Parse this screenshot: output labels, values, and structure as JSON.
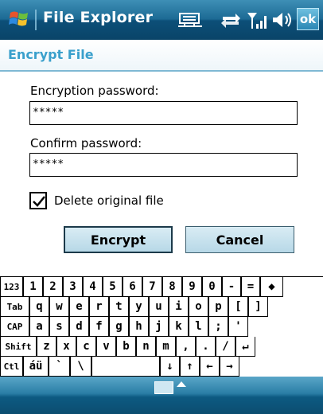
{
  "titlebar": {
    "title": "File Explorer",
    "ok_label": "ok",
    "icons": [
      "windows-start-icon",
      "connectivity-icon",
      "sync-icon",
      "signal-icon",
      "volume-icon"
    ]
  },
  "dialog": {
    "title": "Encrypt File",
    "encryption_label": "Encryption password:",
    "encryption_value": "*****",
    "confirm_label": "Confirm password:",
    "confirm_value": "*****",
    "delete_checkbox_label": "Delete original file",
    "delete_checked": true,
    "encrypt_button": "Encrypt",
    "cancel_button": "Cancel"
  },
  "keyboard": {
    "rows": [
      [
        "123",
        "1",
        "2",
        "3",
        "4",
        "5",
        "6",
        "7",
        "8",
        "9",
        "0",
        "-",
        "=",
        "◆"
      ],
      [
        "Tab",
        "q",
        "w",
        "e",
        "r",
        "t",
        "y",
        "u",
        "i",
        "o",
        "p",
        "[",
        "]"
      ],
      [
        "CAP",
        "a",
        "s",
        "d",
        "f",
        "g",
        "h",
        "j",
        "k",
        "l",
        ";",
        "'"
      ],
      [
        "Shift",
        "z",
        "x",
        "c",
        "v",
        "b",
        "n",
        "m",
        ",",
        ".",
        "/",
        "↵"
      ],
      [
        "Ctl",
        "áü",
        "`",
        "\\",
        "",
        "↓",
        "↑",
        "←",
        "→"
      ]
    ]
  },
  "colors": {
    "titlebar": "#1c6a94",
    "dialog_title": "#3aa0cc",
    "button_fill": "#c7e2ee"
  }
}
